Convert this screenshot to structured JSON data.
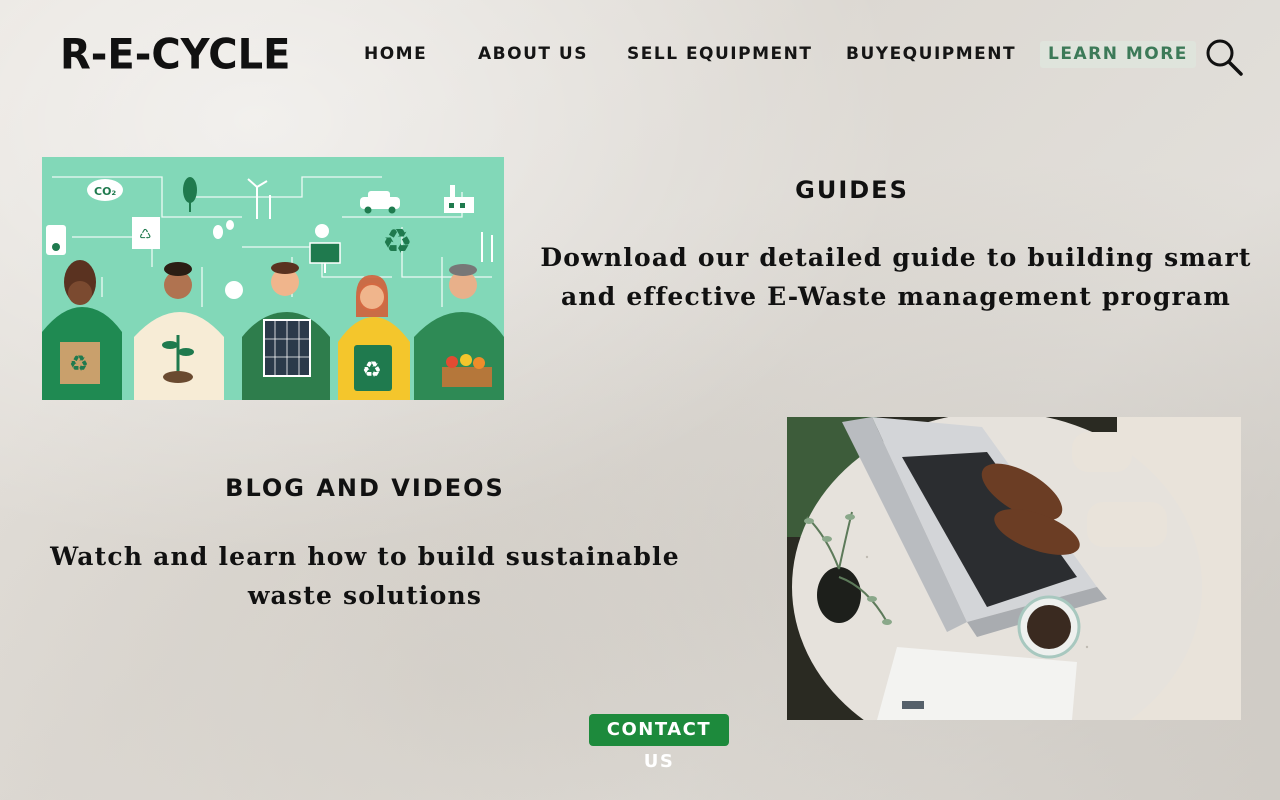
{
  "brand": {
    "logo_text": "R-E-CYCLE"
  },
  "nav": {
    "home": "HOME",
    "about": "ABOUT US",
    "sell": "SELL EQUIPMENT",
    "buy": "BUYEQUIPMENT",
    "learn": "LEARN MORE"
  },
  "guides": {
    "title": "GUIDES",
    "text_line1": "Download our detailed guide to building smart",
    "text_line2": "and effective E-Waste management program"
  },
  "blog": {
    "title": "BLOG AND VIDEOS",
    "text_line1": "Watch and learn how to build sustainable",
    "text_line2": "waste solutions"
  },
  "illustration": {
    "co2_label": "CO₂"
  },
  "cta": {
    "contact": "CONTACT US"
  },
  "colors": {
    "accent_green": "#1d8a3c",
    "learn_more_text": "#3c7a58",
    "illustration_bg": "#7fd6b6",
    "illustration_dark_green": "#1f7a4e"
  },
  "icons": {
    "search": "search-icon"
  }
}
